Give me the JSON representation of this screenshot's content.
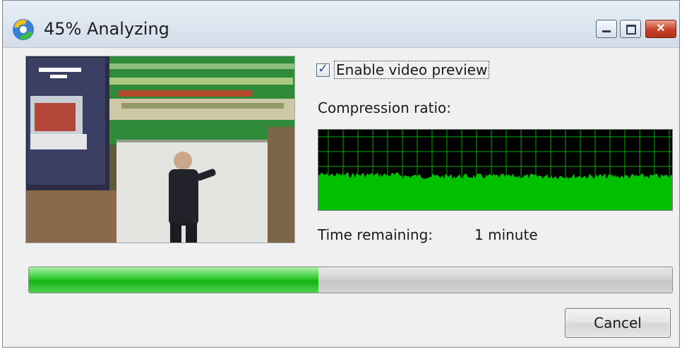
{
  "window": {
    "title": "45% Analyzing",
    "icon": "app-converter-icon",
    "controls": [
      "minimize-icon",
      "maximize-icon",
      "close-icon"
    ]
  },
  "preview": {
    "enable_label": "Enable video preview",
    "enabled": true
  },
  "compression": {
    "label": "Compression ratio:",
    "graph_color": "#00c000",
    "grid_color": "#00aa00"
  },
  "time": {
    "label": "Time remaining:",
    "value": "1 minute"
  },
  "progress": {
    "percent": 45,
    "color": "#22c022"
  },
  "buttons": {
    "cancel": "Cancel"
  }
}
